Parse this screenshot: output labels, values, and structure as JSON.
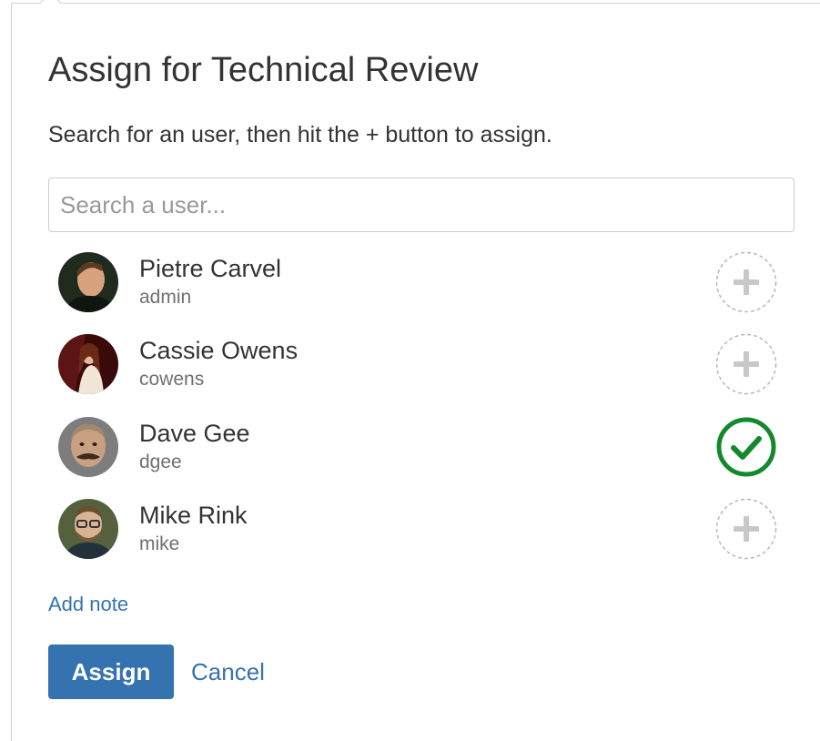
{
  "dialog": {
    "title": "Assign for Technical Review",
    "instructions": "Search for an user, then hit the + button to assign."
  },
  "search": {
    "placeholder": "Search a user...",
    "value": ""
  },
  "users": [
    {
      "name": "Pietre Carvel",
      "username": "admin",
      "assigned": false,
      "avatar_bg": "#2b3a2a"
    },
    {
      "name": "Cassie Owens",
      "username": "cowens",
      "assigned": false,
      "avatar_bg": "#4a1010"
    },
    {
      "name": "Dave Gee",
      "username": "dgee",
      "assigned": true,
      "avatar_bg": "#8a8a8a"
    },
    {
      "name": "Mike Rink",
      "username": "mike",
      "assigned": false,
      "avatar_bg": "#4a5a3a"
    }
  ],
  "footer": {
    "add_note_label": "Add note",
    "assign_label": "Assign",
    "cancel_label": "Cancel"
  },
  "colors": {
    "primary": "#3572b0",
    "assigned": "#14892c",
    "unassigned": "#c8c8c8"
  },
  "icons": {
    "add": "plus-icon",
    "assigned": "check-circle-icon"
  }
}
